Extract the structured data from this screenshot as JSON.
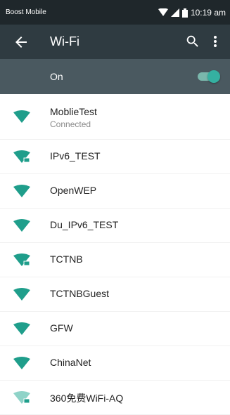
{
  "status_bar": {
    "carrier": "Boost Mobile",
    "time": "10:19 am"
  },
  "app_bar": {
    "title": "Wi-Fi"
  },
  "wifi_toggle": {
    "label": "On",
    "enabled": true
  },
  "colors": {
    "status_bar_bg": "#1f272b",
    "app_bar_bg": "#2f3b41",
    "toggle_bar_bg": "#4a5960",
    "accent_teal": "#1f9e8b"
  },
  "networks": [
    {
      "name": "MoblieTest",
      "status": "Connected",
      "secured": false,
      "icon": "wifi-signal-icon"
    },
    {
      "name": "IPv6_TEST",
      "status": "",
      "secured": true,
      "icon": "wifi-signal-locked-icon"
    },
    {
      "name": "OpenWEP",
      "status": "",
      "secured": false,
      "icon": "wifi-signal-icon"
    },
    {
      "name": "Du_IPv6_TEST",
      "status": "",
      "secured": false,
      "icon": "wifi-signal-icon"
    },
    {
      "name": "TCTNB",
      "status": "",
      "secured": true,
      "icon": "wifi-signal-locked-icon"
    },
    {
      "name": "TCTNBGuest",
      "status": "",
      "secured": false,
      "icon": "wifi-signal-icon"
    },
    {
      "name": "GFW",
      "status": "",
      "secured": false,
      "icon": "wifi-signal-icon"
    },
    {
      "name": "ChinaNet",
      "status": "",
      "secured": false,
      "icon": "wifi-signal-icon"
    },
    {
      "name": "360免费WiFi-AQ",
      "status": "",
      "secured": true,
      "icon": "wifi-signal-locked-icon"
    }
  ]
}
